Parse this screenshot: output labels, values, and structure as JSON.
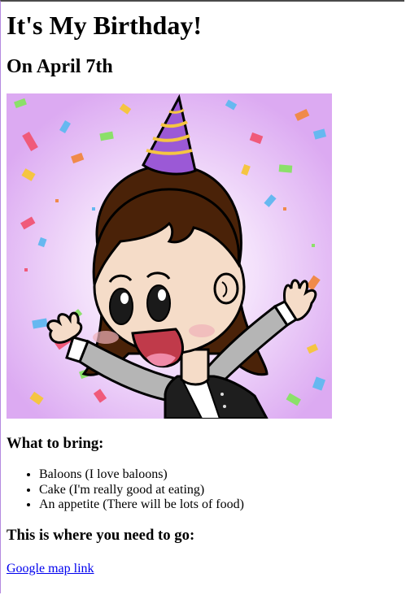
{
  "page": {
    "title": "It's My Birthday!",
    "date_heading": "On April 7th"
  },
  "hero_image": {
    "description_icon": "birthday-girl-illustration",
    "colors": {
      "background": "#e3b8f5",
      "hat": "#9b59d6",
      "hair": "#4a2208",
      "skin": "#f5dcc8",
      "jacket": "#1e1e1e",
      "sleeve": "#b5b5b5"
    }
  },
  "bring_section": {
    "heading": "What to bring:",
    "items": [
      "Baloons (I love baloons)",
      "Cake (I'm really good at eating)",
      "An appetite (There will be lots of food)"
    ]
  },
  "location_section": {
    "heading": "This is where you need to go:",
    "link_label": "Google map link"
  },
  "colors": {
    "link": "#0000ee"
  }
}
